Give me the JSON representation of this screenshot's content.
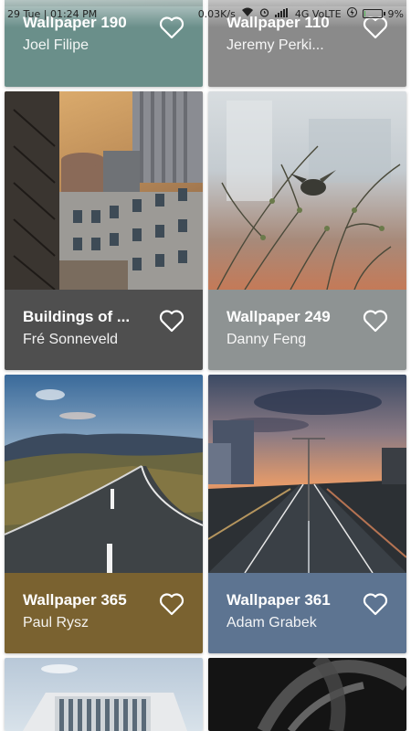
{
  "status_bar": {
    "time": "29 Tue | 01:24 PM",
    "speed": "0.03K/s",
    "network": "4G VoLTE",
    "battery": "9%",
    "battery_level": 0.09
  },
  "cards": [
    {
      "title": "Wallpaper 190",
      "author": "Joel Filipe",
      "footer_color": "#6a8f8a"
    },
    {
      "title": "Wallpaper 110",
      "author": "Jeremy Perki...",
      "footer_color": "#8a8a8a"
    },
    {
      "title": "Buildings of ...",
      "author": "Fré Sonneveld",
      "footer_color": "#4f4f4f"
    },
    {
      "title": "Wallpaper 249",
      "author": "Danny Feng",
      "footer_color": "#8e9393"
    },
    {
      "title": "Wallpaper 365",
      "author": "Paul Rysz",
      "footer_color": "#7a6230"
    },
    {
      "title": "Wallpaper 361",
      "author": "Adam Grabek",
      "footer_color": "#5d7491"
    }
  ],
  "icons": {
    "favorite": "heart-outline-icon"
  }
}
